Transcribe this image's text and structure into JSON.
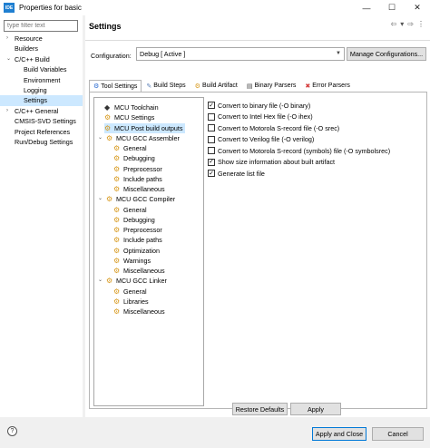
{
  "window": {
    "title": "Properties for basic",
    "app_icon": "IDE"
  },
  "filter": {
    "placeholder": "type filter text"
  },
  "left_tree": [
    {
      "label": "Resource",
      "twist": "›"
    },
    {
      "label": "Builders",
      "twist": ""
    },
    {
      "label": "C/C++ Build",
      "twist": "⌄"
    },
    {
      "label": "Build Variables",
      "twist": ""
    },
    {
      "label": "Environment",
      "twist": ""
    },
    {
      "label": "Logging",
      "twist": ""
    },
    {
      "label": "Settings",
      "twist": ""
    },
    {
      "label": "C/C++ General",
      "twist": "›"
    },
    {
      "label": "CMSIS-SVD Settings",
      "twist": ""
    },
    {
      "label": "Project References",
      "twist": ""
    },
    {
      "label": "Run/Debug Settings",
      "twist": ""
    }
  ],
  "header": {
    "title": "Settings"
  },
  "configuration": {
    "label": "Configuration:",
    "value": "Debug  [ Active ]",
    "manage_label": "Manage Configurations..."
  },
  "tabs": [
    {
      "label": "Tool Settings"
    },
    {
      "label": "Build Steps"
    },
    {
      "label": "Build Artifact"
    },
    {
      "label": "Binary Parsers"
    },
    {
      "label": "Error Parsers"
    }
  ],
  "tool_tree": [
    {
      "label": "MCU Toolchain"
    },
    {
      "label": "MCU Settings"
    },
    {
      "label": "MCU Post build outputs"
    },
    {
      "label": "MCU GCC Assembler"
    },
    {
      "label": "General"
    },
    {
      "label": "Debugging"
    },
    {
      "label": "Preprocessor"
    },
    {
      "label": "Include paths"
    },
    {
      "label": "Miscellaneous"
    },
    {
      "label": "MCU GCC Compiler"
    },
    {
      "label": "General"
    },
    {
      "label": "Debugging"
    },
    {
      "label": "Preprocessor"
    },
    {
      "label": "Include paths"
    },
    {
      "label": "Optimization"
    },
    {
      "label": "Warnings"
    },
    {
      "label": "Miscellaneous"
    },
    {
      "label": "MCU GCC Linker"
    },
    {
      "label": "General"
    },
    {
      "label": "Libraries"
    },
    {
      "label": "Miscellaneous"
    }
  ],
  "options": [
    {
      "label": "Convert to binary file (-O binary)",
      "checked": true
    },
    {
      "label": "Convert to Intel Hex file (-O ihex)",
      "checked": false
    },
    {
      "label": "Convert to Motorola S-record file (-O srec)",
      "checked": false
    },
    {
      "label": "Convert to Verilog file (-O verilog)",
      "checked": false
    },
    {
      "label": "Convert to Motorola S-record (symbols) file (-O symbolsrec)",
      "checked": false
    },
    {
      "label": "Show size information about built artifact",
      "checked": true
    },
    {
      "label": "Generate list file",
      "checked": true
    }
  ],
  "buttons": {
    "restore_defaults": "Restore Defaults",
    "apply": "Apply",
    "apply_and_close": "Apply and Close",
    "cancel": "Cancel",
    "help": "?"
  },
  "check_mark": "✓"
}
